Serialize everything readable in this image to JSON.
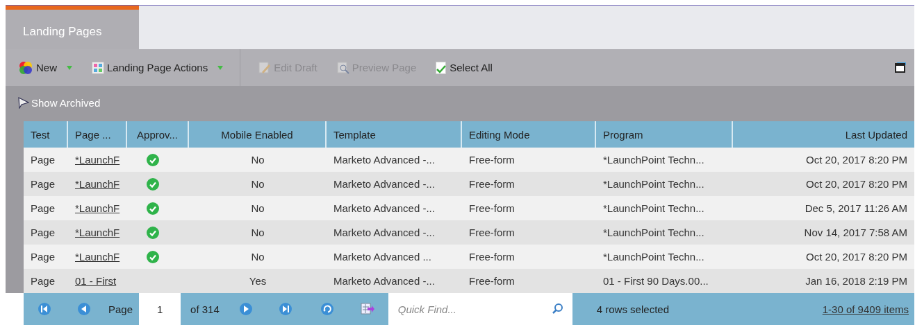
{
  "tab": {
    "label": "Landing Pages",
    "selected": true
  },
  "toolbar": {
    "buttons": [
      {
        "label": "New",
        "kind": "menu",
        "disabled": false
      },
      {
        "label": "Landing Page Actions",
        "kind": "menu",
        "disabled": false
      },
      {
        "label": "Edit Draft",
        "kind": "button",
        "disabled": true
      },
      {
        "label": "Preview Page",
        "kind": "button",
        "disabled": true
      },
      {
        "label": "Select All",
        "kind": "button",
        "disabled": false
      }
    ]
  },
  "filter": {
    "label": "Show Archived"
  },
  "table": {
    "columns": [
      "Test",
      "Page ...",
      "Approv...",
      "Mobile Enabled",
      "Template",
      "Editing Mode",
      "Program",
      "Last Updated"
    ],
    "rows": [
      {
        "test": "Page",
        "page_name": "*LaunchF",
        "approved": true,
        "mobile_enabled": "No",
        "template": "Marketo Advanced -...",
        "editing_mode": "Free-form",
        "program": "*LaunchPoint Techn...",
        "last_updated": "Oct 20, 2017 8:20 PM"
      },
      {
        "test": "Page",
        "page_name": "*LaunchF",
        "approved": true,
        "mobile_enabled": "No",
        "template": "Marketo Advanced -...",
        "editing_mode": "Free-form",
        "program": "*LaunchPoint Techn...",
        "last_updated": "Oct 20, 2017 8:20 PM"
      },
      {
        "test": "Page",
        "page_name": "*LaunchF",
        "approved": true,
        "mobile_enabled": "No",
        "template": "Marketo Advanced -...",
        "editing_mode": "Free-form",
        "program": "*LaunchPoint Techn...",
        "last_updated": "Dec 5, 2017 11:26 AM"
      },
      {
        "test": "Page",
        "page_name": "*LaunchF",
        "approved": true,
        "mobile_enabled": "No",
        "template": "Marketo Advanced -...",
        "editing_mode": "Free-form",
        "program": "*LaunchPoint Techn...",
        "last_updated": "Nov 14, 2017 7:58 AM"
      },
      {
        "test": "Page",
        "page_name": "*LaunchF",
        "approved": true,
        "mobile_enabled": "No",
        "template": "Marketo Advanced ...",
        "editing_mode": "Free-form",
        "program": "*LaunchPoint Techn...",
        "last_updated": "Oct 20, 2017 8:20 PM"
      },
      {
        "test": "Page",
        "page_name": "01 - First",
        "approved": false,
        "mobile_enabled": "Yes",
        "template": "Marketo Advanced -...",
        "editing_mode": "Free-form",
        "program": "01 - First 90 Days.00...",
        "last_updated": "Jan 16, 2018 2:19 PM"
      }
    ]
  },
  "pager": {
    "page_label": "Page",
    "page_value": "1",
    "page_count": "of 314",
    "quick_find": {
      "placeholder": "Quick Find..."
    },
    "selection": "4 rows selected",
    "range": "1-30 of 9409 items"
  }
}
